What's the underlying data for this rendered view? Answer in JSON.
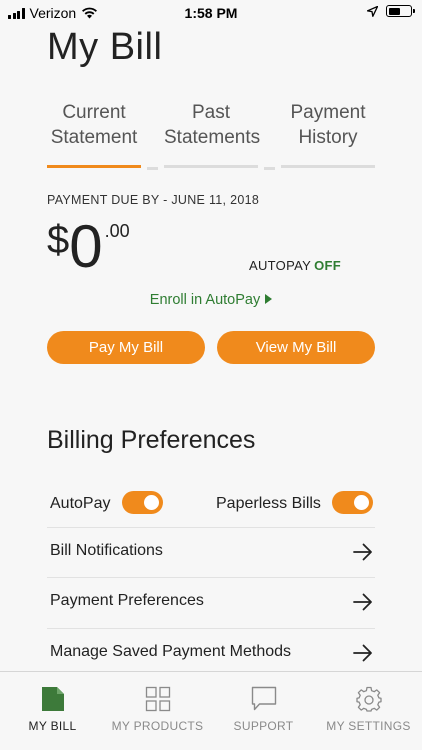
{
  "status_bar": {
    "carrier": "Verizon",
    "time": "1:58 PM"
  },
  "page": {
    "title": "My Bill"
  },
  "tabs": [
    {
      "line1": "Current",
      "line2": "Statement",
      "active": true
    },
    {
      "line1": "Past",
      "line2": "Statements",
      "active": false
    },
    {
      "line1": "Payment",
      "line2": "History",
      "active": false
    }
  ],
  "bill": {
    "due_label": "PAYMENT DUE BY - JUNE 11, 2018",
    "currency": "$",
    "amount_whole": "0",
    "amount_cents": ".00",
    "autopay_label": "AUTOPAY",
    "autopay_value": "OFF",
    "enroll_link": "Enroll in AutoPay",
    "pay_button": "Pay My Bill",
    "view_button": "View My Bill"
  },
  "preferences": {
    "title": "Billing Preferences",
    "autopay_label": "AutoPay",
    "autopay_on": true,
    "paperless_label": "Paperless Bills",
    "paperless_on": true,
    "rows": [
      {
        "label": "Bill Notifications"
      },
      {
        "label": "Payment Preferences"
      },
      {
        "label": "Manage Saved Payment Methods"
      }
    ]
  },
  "bottom_nav": [
    {
      "label": "MY BILL",
      "icon": "document-icon",
      "active": true
    },
    {
      "label": "MY PRODUCTS",
      "icon": "grid-icon",
      "active": false
    },
    {
      "label": "SUPPORT",
      "icon": "chat-bubble-icon",
      "active": false
    },
    {
      "label": "MY SETTINGS",
      "icon": "gear-icon",
      "active": false
    }
  ],
  "colors": {
    "accent": "#f08a1c",
    "green": "#2f7d32",
    "background": "#f7f7f7"
  }
}
